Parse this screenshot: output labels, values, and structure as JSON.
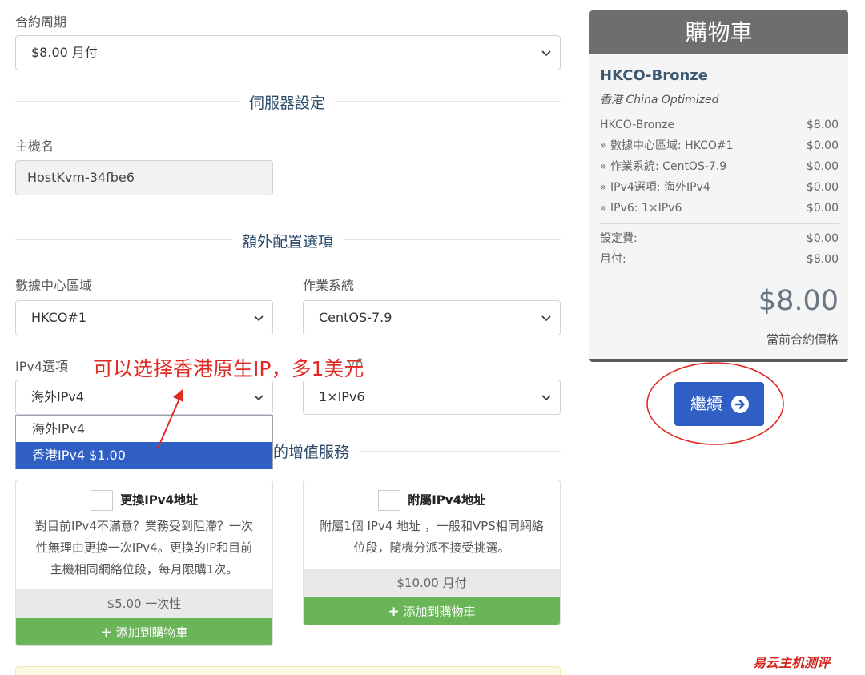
{
  "billing": {
    "label": "合約周期",
    "value": "$8.00 月付"
  },
  "server_section": {
    "title": "伺服器設定",
    "hostname_label": "主機名",
    "hostname_value": "HostKvm-34fbe6"
  },
  "extra_section": {
    "title": "額外配置選項"
  },
  "datacenter": {
    "label": "數據中心區域",
    "value": "HKCO#1"
  },
  "os": {
    "label": "作業系統",
    "value": "CentOS-7.9"
  },
  "ipv4": {
    "label": "IPv4選項",
    "value": "海外IPv4",
    "options": [
      "海外IPv4",
      "香港IPv4 $1.00"
    ]
  },
  "ipv6": {
    "label": "IPv6",
    "label_visible": "v6",
    "value": "1×IPv6"
  },
  "annotation": "可以选择香港原生IP，多1美元",
  "addons_section": {
    "title_visible": "的增值服務"
  },
  "addons": [
    {
      "title": "更換IPv4地址",
      "desc": [
        "對目前IPv4不滿意？業務受到阻滯？一次",
        "性無理由更換一次IPv4。更換的IP和目前",
        "主機相同網絡位段，每月限購1次。"
      ],
      "price": "$5.00 一次性",
      "add_label": "添加到購物車"
    },
    {
      "title": "附屬IPv4地址",
      "desc": [
        "附屬1個 IPv4 地址 ，一般和VPS相同網絡",
        "位段，隨機分派不接受挑選。"
      ],
      "price": "$10.00 月付",
      "add_label": "添加到購物車"
    }
  ],
  "cart": {
    "title": "購物車",
    "product": "HKCO-Bronze",
    "subtitle": "香港 China Optimized",
    "lines": [
      {
        "label": "HKCO-Bronze",
        "value": "$8.00"
      },
      {
        "label": "» 數據中心區域: HKCO#1",
        "value": "$0.00"
      },
      {
        "label": "» 作業系統: CentOS-7.9",
        "value": "$0.00"
      },
      {
        "label": "» IPv4選項: 海外IPv4",
        "value": "$0.00"
      },
      {
        "label": "» IPv6: 1×IPv6",
        "value": "$0.00"
      }
    ],
    "totals": [
      {
        "label": "設定費:",
        "value": "$0.00"
      },
      {
        "label": "月付:",
        "value": "$8.00"
      }
    ],
    "total": "$8.00",
    "total_caption": "當前合約價格"
  },
  "continue_label": "繼續",
  "watermark": "易云主机测评",
  "colors": {
    "primary": "#2f5fc4",
    "green": "#6ab557",
    "annotation": "#e02a23",
    "cart_head": "#6e6e6e"
  },
  "icons": [
    "chevron-down-icon",
    "plus-icon",
    "arrow-right-circle-icon"
  ]
}
